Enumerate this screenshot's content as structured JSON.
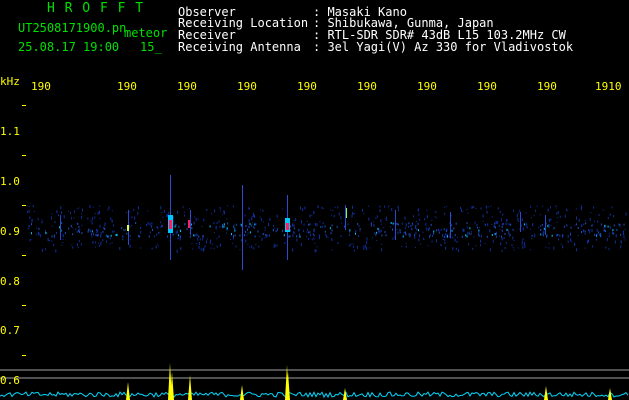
{
  "header": {
    "program": "H R O F F T",
    "filename": "UT2508171900.pn",
    "mode": "meteor",
    "datetime": "25.08.17 19:00",
    "interval": "15_"
  },
  "info": {
    "observer_label": "Observer",
    "observer_value": ": Masaki Kano",
    "location_label": "Receiving Location",
    "location_value": ": Shibukawa, Gunma, Japan",
    "receiver_label": "Receiver",
    "receiver_value": ": RTL-SDR SDR# 43dB L15 103.2MHz CW",
    "antenna_label": "Receiving Antenna",
    "antenna_value": ": 3el Yagi(V) Az 330 for Vladivostok"
  },
  "axes": {
    "y_unit": "kHz",
    "x_ticks": [
      "190",
      "190",
      "190",
      "190",
      "190",
      "190",
      "190",
      "190",
      "190",
      "1910"
    ],
    "y_ticks": [
      "1.1",
      "1.0",
      "0.9",
      "0.8",
      "0.7",
      "0.6"
    ]
  },
  "colors": {
    "background": "#000000",
    "header_text": "#00e000",
    "info_text": "#ffffff",
    "axis_text": "#ffff00",
    "signal_low": "#1030a0",
    "signal_mid": "#00c8ff",
    "signal_high": "#ff2060",
    "amplitude_trace": "#00d8ff",
    "amplitude_spike": "#ffff00"
  }
}
